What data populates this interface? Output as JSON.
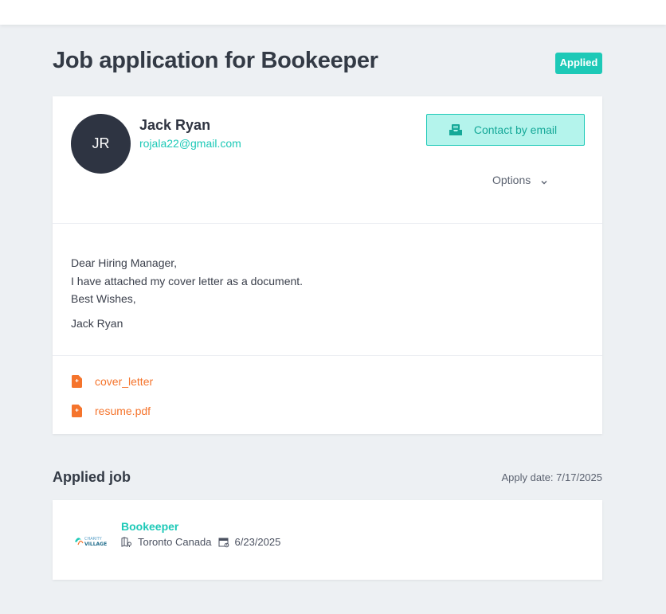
{
  "page": {
    "title": "Job application for Bookeeper",
    "status": "Applied"
  },
  "applicant": {
    "initials": "JR",
    "name": "Jack Ryan",
    "email": "rojala22@gmail.com",
    "contact_label": "Contact by email",
    "options_label": "Options"
  },
  "letter": {
    "lines": [
      "Dear Hiring Manager,",
      "I have attached my cover letter as a document.",
      "Best Wishes,"
    ],
    "signature": "Jack Ryan"
  },
  "attachments": [
    {
      "name": "cover_letter",
      "icon": "file-icon"
    },
    {
      "name": "resume.pdf",
      "icon": "file-icon"
    }
  ],
  "applied_job": {
    "section_title": "Applied job",
    "apply_date": "Apply date: 7/17/2025",
    "job_title": "Bookeeper",
    "location": "Toronto Canada",
    "date": "6/23/2025",
    "logo_text": [
      "CHARITY",
      "VILLAGE"
    ]
  },
  "colors": {
    "accent": "#1dc9b7",
    "attachment": "#f5742c",
    "avatar_bg": "#2e3442",
    "background": "#edf0f3"
  }
}
